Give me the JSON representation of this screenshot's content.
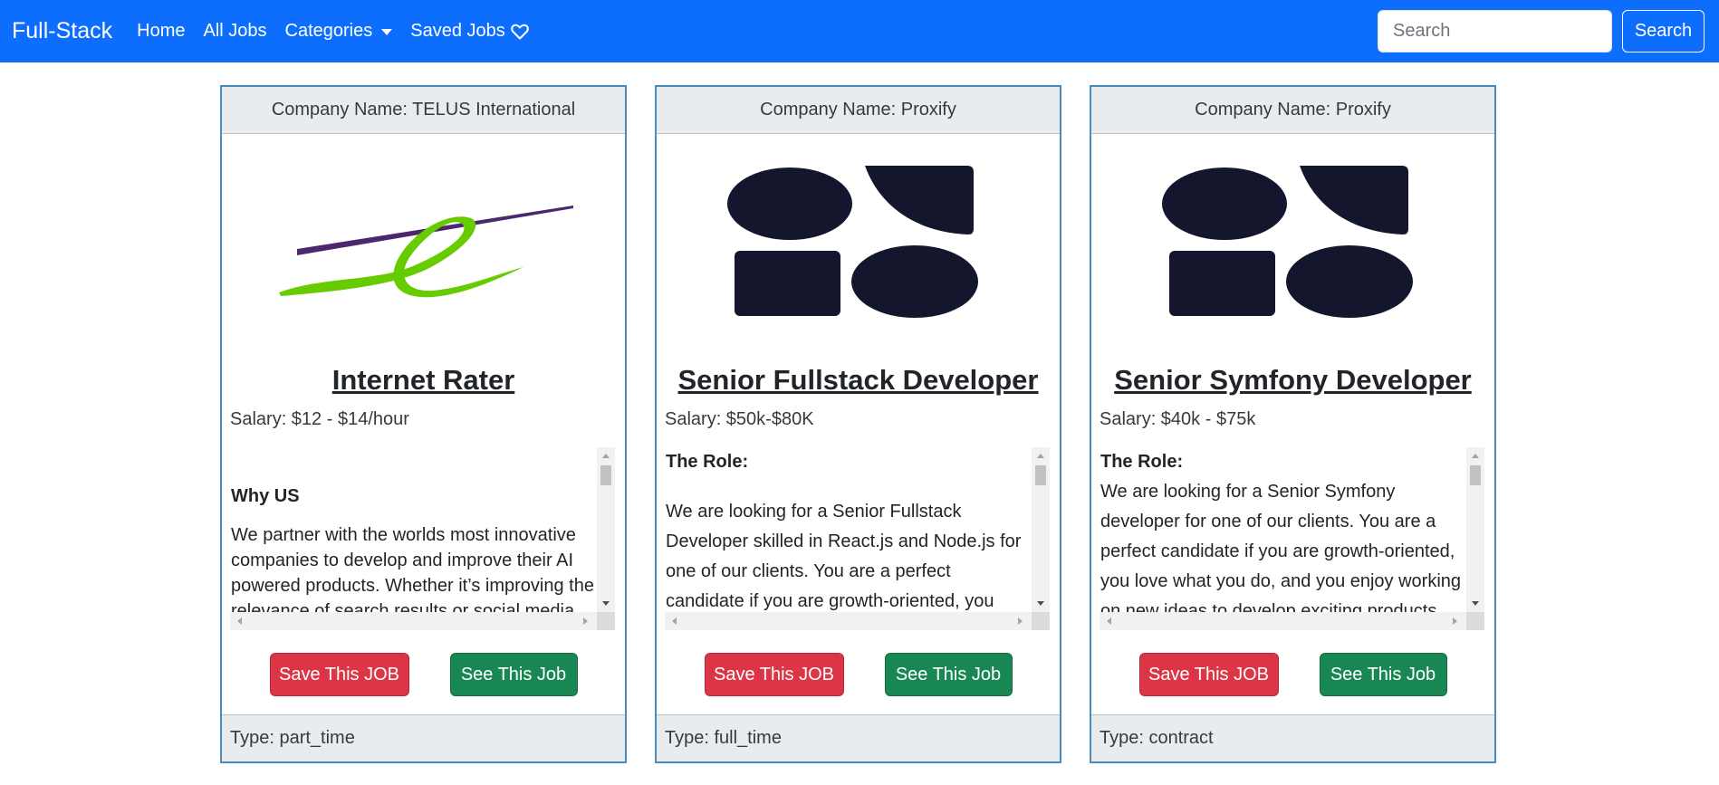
{
  "navbar": {
    "brand": "Full-Stack",
    "links": {
      "home": "Home",
      "all_jobs": "All Jobs",
      "categories": "Categories",
      "saved_jobs": "Saved Jobs"
    },
    "search": {
      "placeholder": "Search",
      "value": "",
      "button_label": "Search"
    },
    "colors": {
      "background": "#0d6efd"
    }
  },
  "cards": [
    {
      "company": "Company Name: TELUS International",
      "logo_icon": "telus-international-logo",
      "title": "Internet Rater",
      "salary": "Salary: $12 - $14/hour",
      "description": {
        "heading": "Why US",
        "text": "We partner with the worlds most innovative companies to develop and improve their AI powered products. Whether it’s improving the relevance of search results or social media feeds"
      },
      "save_label": "Save This JOB",
      "see_label": "See This Job",
      "type": "Type: part_time"
    },
    {
      "company": "Company Name: Proxify",
      "logo_icon": "proxify-logo",
      "title": "Senior Fullstack Developer",
      "salary": "Salary: $50k-$80K",
      "description": {
        "heading": "The Role:",
        "text": "We are looking for a Senior Fullstack Developer skilled in React.js and Node.js for one of our clients. You are a perfect candidate if you are growth-oriented, you"
      },
      "save_label": "Save This JOB",
      "see_label": "See This Job",
      "type": "Type: full_time"
    },
    {
      "company": "Company Name: Proxify",
      "logo_icon": "proxify-logo",
      "title": "Senior Symfony Developer",
      "salary": "Salary: $40k - $75k",
      "description": {
        "heading": "The Role:",
        "text": "We are looking for a Senior Symfony developer for one of our clients. You are a perfect candidate if you are growth-oriented, you love what you do, and you enjoy working on new ideas to develop exciting products"
      },
      "save_label": "Save This JOB",
      "see_label": "See This Job",
      "type": "Type: contract"
    }
  ]
}
